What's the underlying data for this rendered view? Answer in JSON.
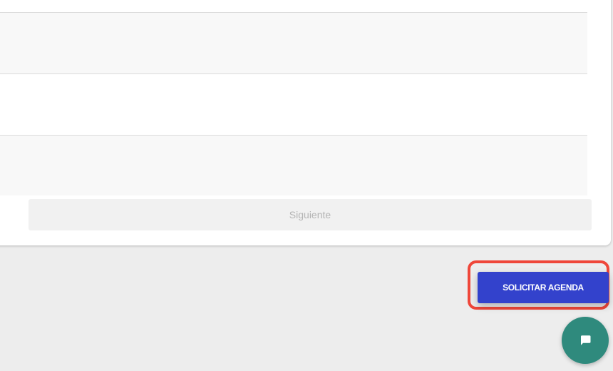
{
  "form": {
    "next_label": "Siguiente"
  },
  "actions": {
    "request_agenda_label": "SOLICITAR AGENDA"
  },
  "chat": {
    "icon": "chat-bubble-icon"
  },
  "colors": {
    "page_background": "#ededed",
    "card_background": "#ffffff",
    "alt_row_background": "#f8f8f8",
    "next_button_background": "#f1f1f1",
    "next_button_text": "#b4b4b4",
    "primary_button": "#3342cc",
    "highlight_outline": "#ef473a",
    "chat_button": "#2f8a7d"
  }
}
